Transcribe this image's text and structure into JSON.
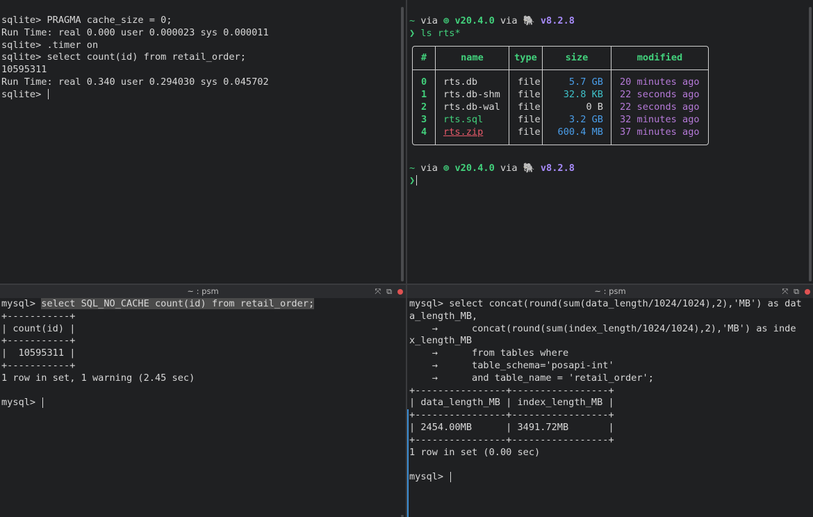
{
  "top_left": {
    "lines": [
      "sqlite> PRAGMA cache_size = 0;",
      "Run Time: real 0.000 user 0.000023 sys 0.000011",
      "sqlite> .timer on",
      "sqlite> select count(id) from retail_order;",
      "10595311",
      "Run Time: real 0.340 user 0.294030 sys 0.045702",
      "sqlite> "
    ]
  },
  "top_right": {
    "prompt1": {
      "tilde": "~",
      "via1": " via ",
      "node_icon": "⊚ ",
      "node_ver": "v20.4.0",
      "via2": " via ",
      "php_icon": "🐘 ",
      "php_ver": "v8.2.8"
    },
    "cmd_arrow": "❯",
    "cmd": " ls rts*",
    "table": {
      "headers": [
        "#",
        "name",
        "type",
        "size",
        "modified"
      ],
      "rows": [
        {
          "idx": "0",
          "name": "rts.db",
          "type": "file",
          "size": "5.7 GB",
          "modified": "20 minutes ago"
        },
        {
          "idx": "1",
          "name": "rts.db-shm",
          "type": "file",
          "size": "32.8 KB",
          "modified": "22 seconds ago"
        },
        {
          "idx": "2",
          "name": "rts.db-wal",
          "type": "file",
          "size": "0 B",
          "modified": "22 seconds ago"
        },
        {
          "idx": "3",
          "name": "rts.sql",
          "type": "file",
          "size": "3.2 GB",
          "modified": "32 minutes ago"
        },
        {
          "idx": "4",
          "name": "rts.zip",
          "type": "file",
          "size": "600.4 MB",
          "modified": "37 minutes ago"
        }
      ]
    },
    "prompt2": {
      "tilde": "~",
      "via1": " via ",
      "node_icon": "⊚ ",
      "node_ver": "v20.4.0",
      "via2": " via ",
      "php_icon": "🐘 ",
      "php_ver": "v8.2.8"
    },
    "prompt_arrow": "❯"
  },
  "bottom_left": {
    "title": "~ : psm",
    "prompt": "mysql> ",
    "query": "select SQL_NO_CACHE count(id) from retail_order;",
    "lines": [
      "+-----------+",
      "| count(id) |",
      "+-----------+",
      "|  10595311 |",
      "+-----------+",
      "1 row in set, 1 warning (2.45 sec)",
      "",
      "mysql> "
    ]
  },
  "bottom_right": {
    "title": "~ : psm",
    "lines": [
      "mysql> select concat(round(sum(data_length/1024/1024),2),'MB') as dat",
      "a_length_MB,",
      "    →      concat(round(sum(index_length/1024/1024),2),'MB') as inde",
      "x_length_MB",
      "    →      from tables where",
      "    →      table_schema='posapi-int'",
      "    →      and table_name = 'retail_order';",
      "+----------------+-----------------+",
      "| data_length_MB | index_length_MB |",
      "+----------------+-----------------+",
      "| 2454.00MB      | 3491.72MB       |",
      "+----------------+-----------------+",
      "1 row in set (0.00 sec)",
      "",
      "mysql> "
    ]
  },
  "colors": {
    "accent_green": "#42d17c",
    "accent_purple": "#a78bfa",
    "close_red": "#e05252"
  }
}
